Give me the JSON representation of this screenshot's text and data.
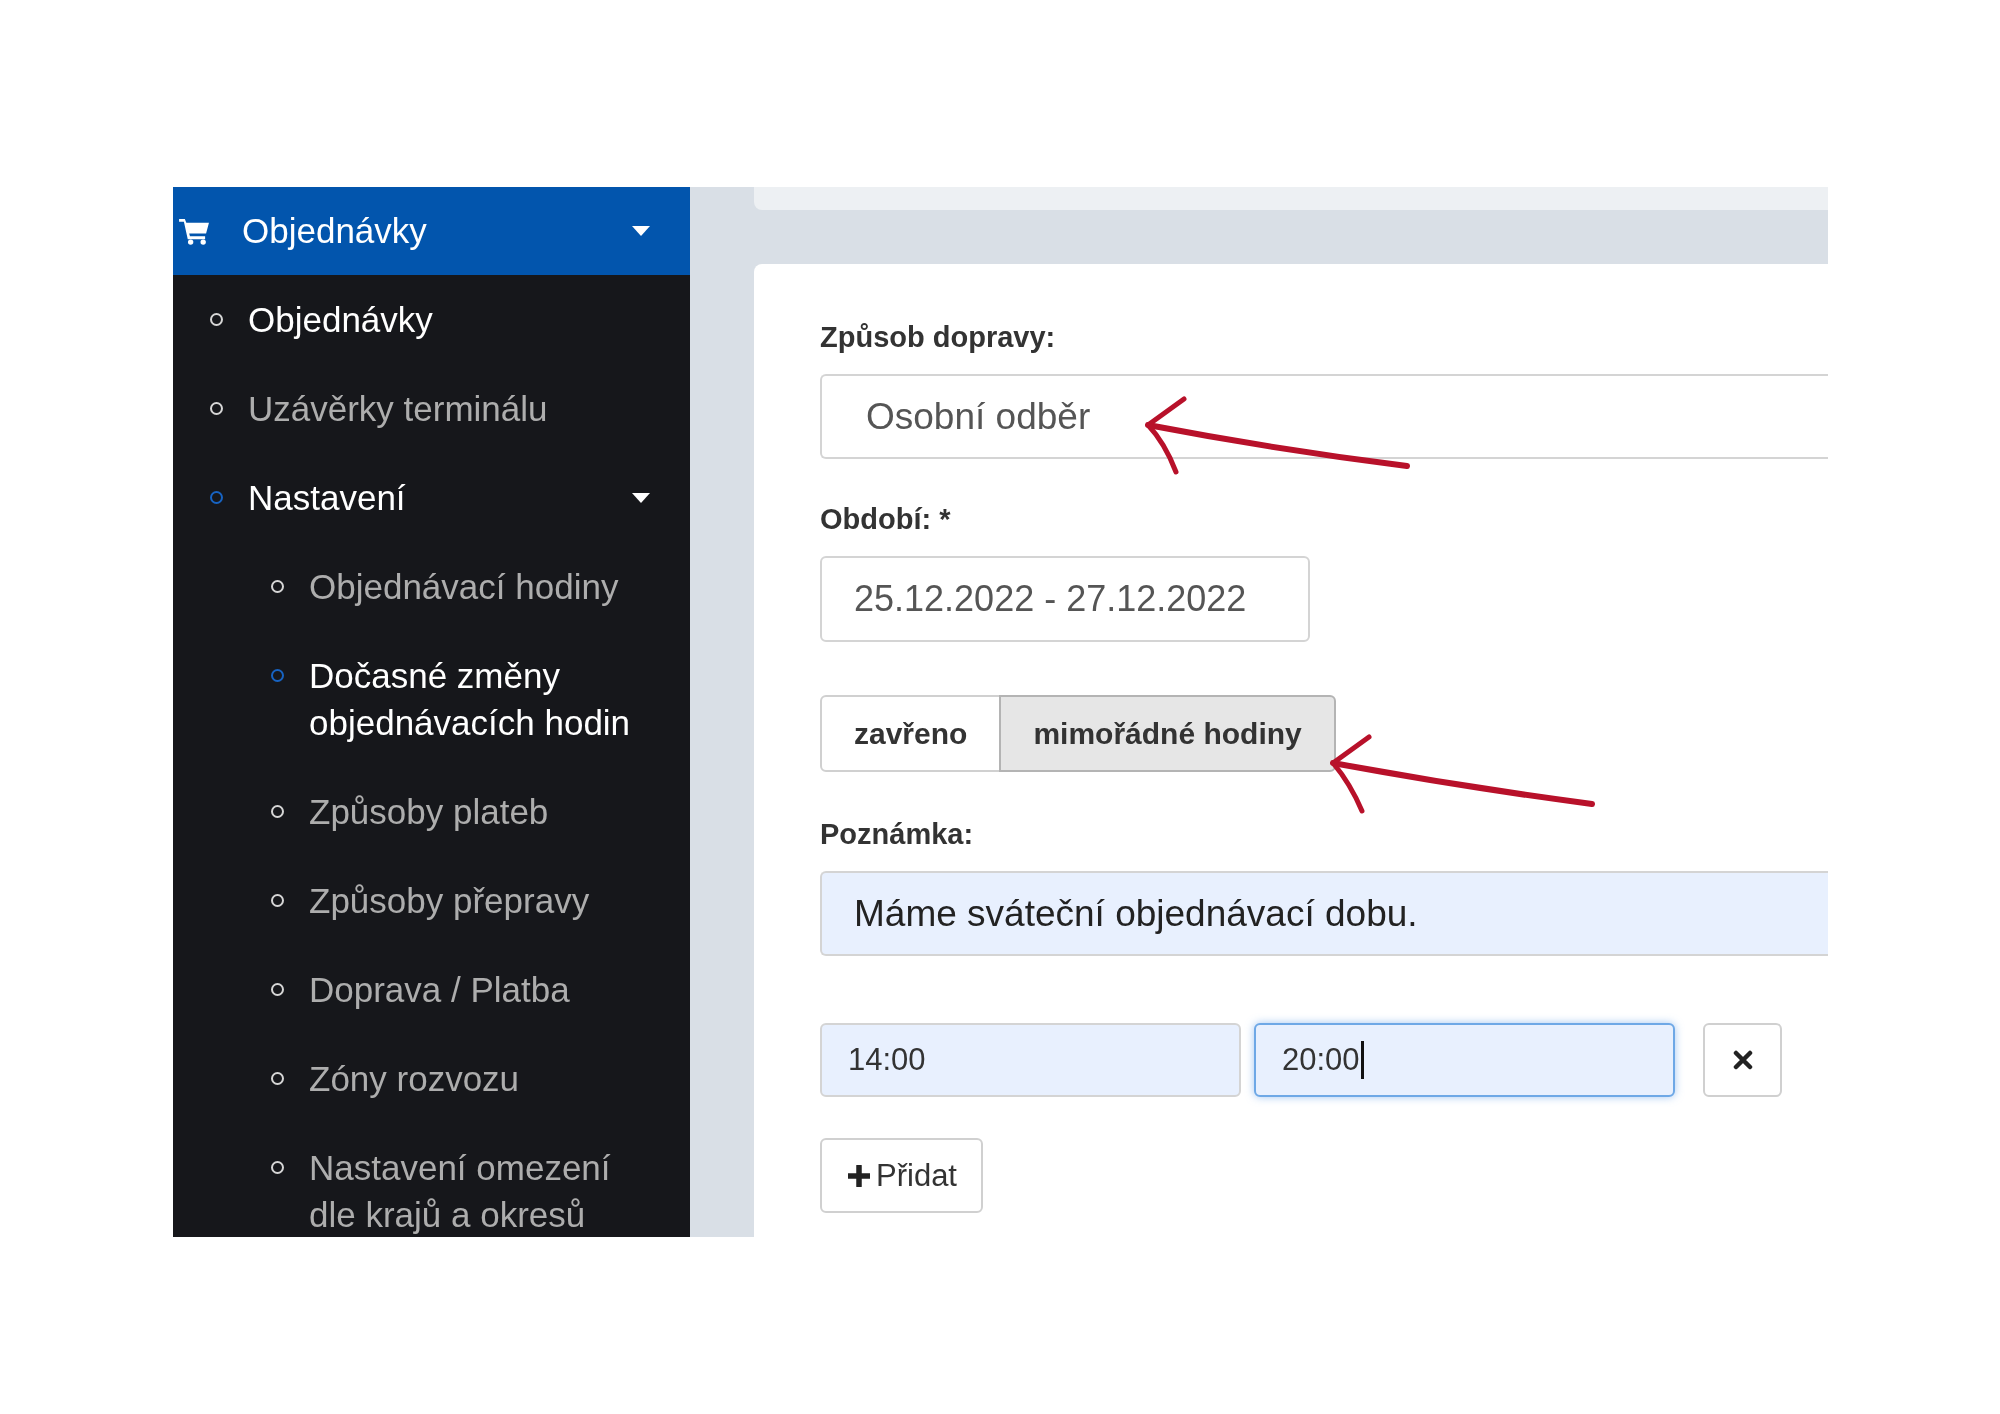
{
  "sidebar": {
    "header": {
      "label": "Objednávky",
      "expanded": true
    },
    "items": [
      {
        "label": "Objednávky",
        "highlighted": true,
        "selected": false
      },
      {
        "label": "Uzávěrky terminálu",
        "highlighted": false,
        "selected": false
      },
      {
        "label": "Nastavení",
        "highlighted": true,
        "selected": true,
        "expanded": true,
        "children": [
          {
            "label": "Objednávací hodiny",
            "selected": false
          },
          {
            "label": "Dočasné změny objednávacích hodin",
            "selected": true
          },
          {
            "label": "Způsoby plateb",
            "selected": false
          },
          {
            "label": "Způsoby přepravy",
            "selected": false
          },
          {
            "label": "Doprava / Platba",
            "selected": false
          },
          {
            "label": "Zóny rozvozu",
            "selected": false
          },
          {
            "label": "Nastavení omezení dle krajů a okresů",
            "selected": false
          }
        ]
      }
    ]
  },
  "form": {
    "transport": {
      "label": "Způsob dopravy:",
      "value": "Osobní odběr",
      "autofilled": false
    },
    "period": {
      "label": "Období: *",
      "value": "25.12.2022 - 27.12.2022",
      "autofilled": false
    },
    "mode_toggle": [
      {
        "label": "zavřeno",
        "selected": false
      },
      {
        "label": "mimořádné hodiny",
        "selected": true
      }
    ],
    "note": {
      "label": "Poznámka:",
      "value": "Máme sváteční objednávací dobu.",
      "autofilled": true
    },
    "time_ranges": [
      {
        "from": {
          "value": "14:00",
          "autofilled": true,
          "focused": false
        },
        "to": {
          "value": "20:00",
          "autofilled": true,
          "focused": true
        }
      }
    ],
    "add_button": {
      "label": "Přidat"
    }
  },
  "annotations": [
    {
      "kind": "arrow"
    },
    {
      "kind": "arrow"
    }
  ]
}
